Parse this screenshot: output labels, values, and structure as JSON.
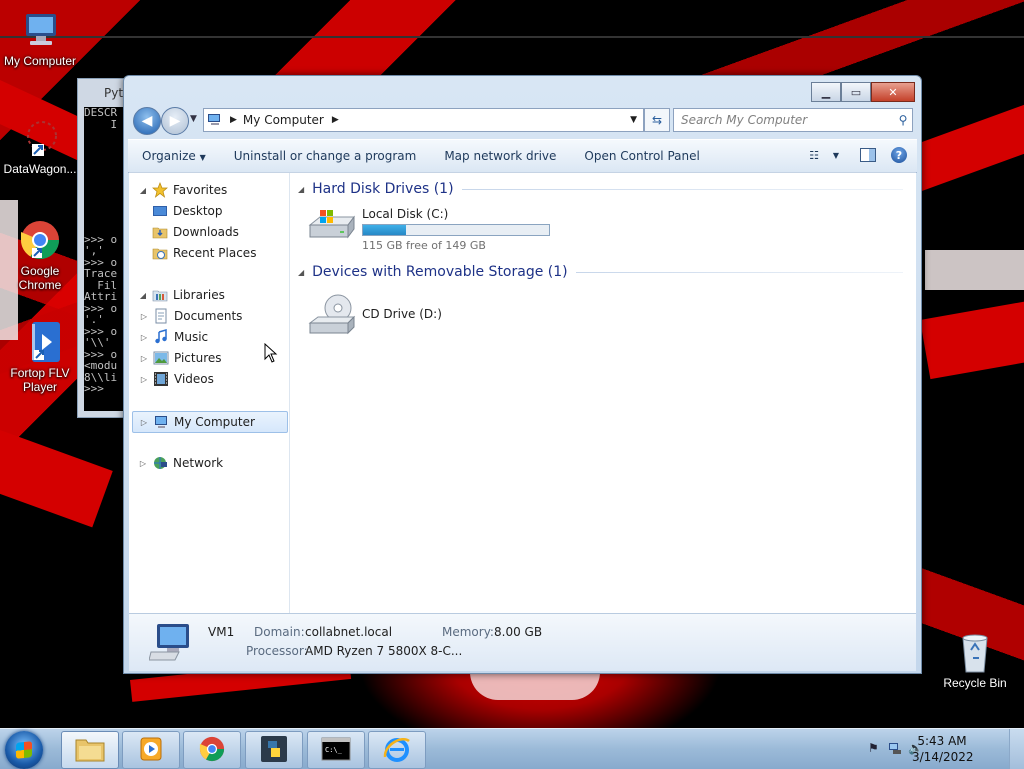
{
  "desktop": {
    "icons": [
      {
        "label": "My Computer"
      },
      {
        "label": "DataWagon..."
      },
      {
        "label": "Google Chrome"
      },
      {
        "label": "Fortop FLV Player"
      },
      {
        "label": "Recycle Bin"
      }
    ]
  },
  "console": {
    "title": "Pyt",
    "lines": "DESCR\n    I\n\n\n\n\n\n\n\n\n\n>>> o\n','\n>>> o\nTrace\n  Fil\nAttri\n>>> o\n'.'\n>>> o\n'\\\\'\n>>> o\n<modu\n8\\\\li\n>>>"
  },
  "window": {
    "address": {
      "crumb": "My Computer"
    },
    "search": {
      "placeholder": "Search My Computer"
    },
    "toolbar": {
      "organize": "Organize",
      "uninstall": "Uninstall or change a program",
      "map_drive": "Map network drive",
      "control_panel": "Open Control Panel"
    },
    "nav": {
      "favorites": "Favorites",
      "desktop": "Desktop",
      "downloads": "Downloads",
      "recent": "Recent Places",
      "libraries": "Libraries",
      "documents": "Documents",
      "music": "Music",
      "pictures": "Pictures",
      "videos": "Videos",
      "my_computer": "My Computer",
      "network": "Network"
    },
    "groups": {
      "hdd": "Hard Disk Drives (1)",
      "removable": "Devices with Removable Storage (1)"
    },
    "drives": {
      "c_name": "Local Disk (C:)",
      "c_free": "115 GB free of 149 GB",
      "c_used_fraction": 0.23,
      "d_name": "CD Drive (D:)"
    },
    "details": {
      "name": "VM1",
      "domain_label": "Domain:",
      "domain_value": "collabnet.local",
      "memory_label": "Memory:",
      "memory_value": "8.00 GB",
      "processor_label": "Processor:",
      "processor_value": "AMD Ryzen 7 5800X 8-C..."
    }
  },
  "taskbar": {
    "time": "5:43 AM",
    "date": "3/14/2022"
  }
}
